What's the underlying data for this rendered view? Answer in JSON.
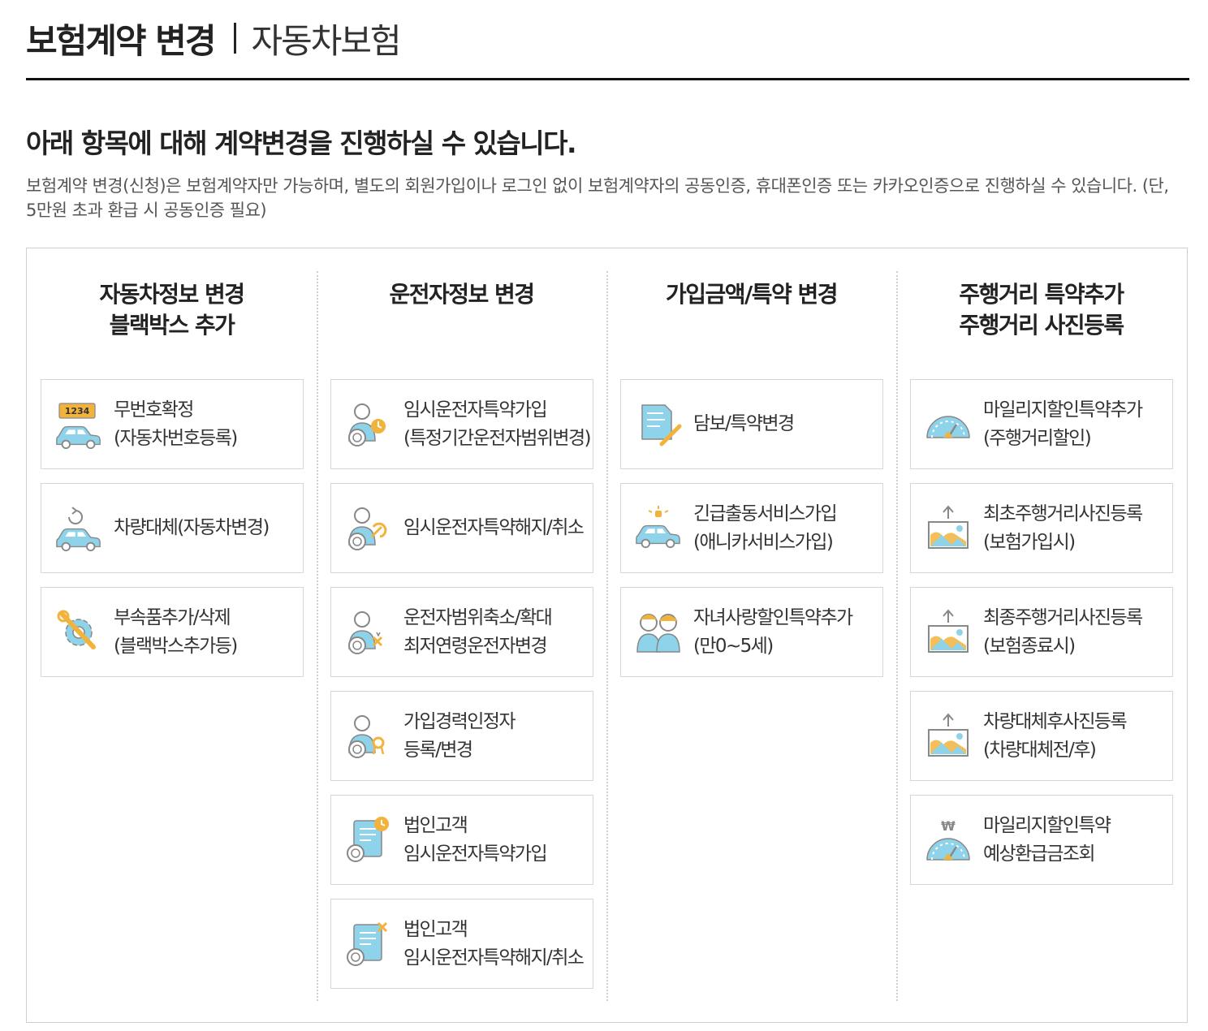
{
  "header": {
    "title": "보험계약 변경",
    "subtitle": "자동차보험"
  },
  "intro": {
    "title": "아래 항목에 대해 계약변경을 진행하실 수 있습니다.",
    "desc": "보험계약 변경(신청)은 보험계약자만 가능하며, 별도의 회원가입이나 로그인 없이 보험계약자의 공동인증, 휴대폰인증 또는 카카오인증으로 진행하실 수 있습니다. (단, 5만원 초과 환급 시 공동인증 필요)"
  },
  "colors": {
    "icon_blue": "#8fd3ea",
    "icon_orange": "#f2b33d",
    "icon_gray": "#888888"
  },
  "columns": [
    {
      "title": [
        "자동차정보 변경",
        "블랙박스 추가"
      ],
      "items": [
        {
          "line1": "무번호확정",
          "line2": "(자동차번호등록)",
          "icon": "license-plate-car-icon",
          "plate": "1234"
        },
        {
          "line1": "차량대체(자동차변경)",
          "line2": "",
          "icon": "car-replace-icon"
        },
        {
          "line1": "부속품추가/삭제",
          "line2": "(블랙박스추가등)",
          "icon": "gear-wrench-icon"
        }
      ]
    },
    {
      "title": [
        "운전자정보 변경",
        ""
      ],
      "items": [
        {
          "line1": "임시운전자특약가입",
          "line2": "(특정기간운전자범위변경)",
          "icon": "driver-clock-icon"
        },
        {
          "line1": "임시운전자특약해지/취소",
          "line2": "",
          "icon": "driver-cancel-icon"
        },
        {
          "line1": "운전자범위축소/확대",
          "line2": "최저연령운전자변경",
          "icon": "driver-range-icon"
        },
        {
          "line1": "가입경력인정자",
          "line2": "등록/변경",
          "icon": "driver-career-icon"
        },
        {
          "line1": "법인고객",
          "line2": "임시운전자특약가입",
          "icon": "corporate-document-clock-icon"
        },
        {
          "line1": "법인고객",
          "line2": "임시운전자특약해지/취소",
          "icon": "corporate-document-cancel-icon"
        }
      ]
    },
    {
      "title": [
        "가입금액/특약 변경",
        ""
      ],
      "items": [
        {
          "line1": "담보/특약변경",
          "line2": "",
          "icon": "document-edit-icon"
        },
        {
          "line1": "긴급출동서비스가입",
          "line2": "(애니카서비스가입)",
          "icon": "emergency-car-icon"
        },
        {
          "line1": "자녀사랑할인특약추가",
          "line2": "(만0~5세)",
          "icon": "children-icon"
        }
      ]
    },
    {
      "title": [
        "주행거리 특약추가",
        "주행거리 사진등록"
      ],
      "items": [
        {
          "line1": "마일리지할인특약추가",
          "line2": "(주행거리할인)",
          "icon": "speedometer-icon"
        },
        {
          "line1": "최초주행거리사진등록",
          "line2": "(보험가입시)",
          "icon": "photo-upload-icon"
        },
        {
          "line1": "최종주행거리사진등록",
          "line2": "(보험종료시)",
          "icon": "photo-upload-icon"
        },
        {
          "line1": "차량대체후사진등록",
          "line2": "(차량대체전/후)",
          "icon": "photo-upload-icon"
        },
        {
          "line1": "마일리지할인특약",
          "line2": "예상환급금조회",
          "icon": "refund-speedometer-icon",
          "symbol": "₩"
        }
      ]
    }
  ]
}
